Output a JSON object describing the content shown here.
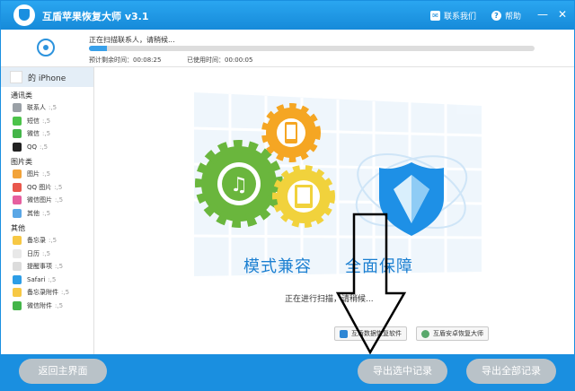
{
  "app": {
    "title": "互盾苹果恢复大师 v3.1",
    "contact": "联系我们",
    "help": "帮助",
    "minimize": "—",
    "close": "✕"
  },
  "progress": {
    "status": "正在扫描联系人，请稍候...",
    "remaining": "预计剩余时间：00:08:25",
    "elapsed": "已使用时间：00:00:05",
    "percent": 4
  },
  "sidebar": {
    "device": "的 iPhone",
    "groups": [
      {
        "label": "通讯类",
        "items": [
          {
            "label": "联系人",
            "icon": "contacts-icon",
            "color": "#9aa0a6"
          },
          {
            "label": "短信",
            "icon": "sms-icon",
            "color": "#4cc34a"
          },
          {
            "label": "微信",
            "icon": "wechat-icon",
            "color": "#44b549"
          },
          {
            "label": "QQ",
            "icon": "qq-icon",
            "color": "#222222"
          }
        ]
      },
      {
        "label": "图片类",
        "items": [
          {
            "label": "图片",
            "icon": "photos-icon",
            "color": "#f2a33a"
          },
          {
            "label": "QQ 图片",
            "icon": "qq-photos-icon",
            "color": "#e9574c"
          },
          {
            "label": "微信图片",
            "icon": "wechat-photos-icon",
            "color": "#e65f9f"
          },
          {
            "label": "其他",
            "icon": "other-photos-icon",
            "color": "#5aa7e6"
          }
        ]
      },
      {
        "label": "其他",
        "items": [
          {
            "label": "备忘录",
            "icon": "notes-icon",
            "color": "#f7c844"
          },
          {
            "label": "日历",
            "icon": "calendar-icon",
            "color": "#e8e8e8"
          },
          {
            "label": "提醒事项",
            "icon": "reminders-icon",
            "color": "#dcdcdc"
          },
          {
            "label": "Safari",
            "icon": "safari-icon",
            "color": "#2d9de6"
          },
          {
            "label": "备忘录附件",
            "icon": "notes-attachment-icon",
            "color": "#f7c844"
          },
          {
            "label": "微信附件",
            "icon": "wechat-attachment-icon",
            "color": "#44b549"
          }
        ]
      }
    ],
    "count": ":,5"
  },
  "main": {
    "title_left": "模式兼容",
    "title_right": "全面保障",
    "status": "正在进行扫描，请稍候...",
    "promo_1": "互盾数据恢复软件",
    "promo_2": "互盾安卓恢复大师"
  },
  "footer": {
    "back": "返回主界面",
    "export_selected": "导出选中记录",
    "export_all": "导出全部记录"
  },
  "colors": {
    "accent": "#1a8fe0",
    "gear_green": "#6ab63d",
    "gear_orange": "#f5a623",
    "gear_yellow": "#f1d23c",
    "shield_blue": "#1e90e6"
  }
}
